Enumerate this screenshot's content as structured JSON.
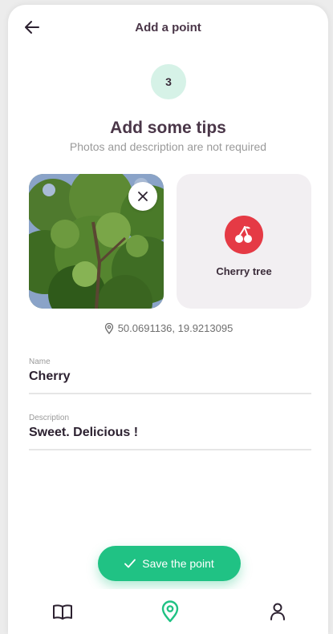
{
  "header": {
    "title": "Add a point"
  },
  "step": {
    "number": "3"
  },
  "content": {
    "title": "Add some tips",
    "subtitle": "Photos and description are not required"
  },
  "category": {
    "label": "Cherry tree",
    "icon": "cherry-icon",
    "color": "#e53a45"
  },
  "location": {
    "coordinates": "50.0691136, 19.9213095"
  },
  "form": {
    "name_label": "Name",
    "name_value": "Cherry",
    "description_label": "Description",
    "description_value": "Sweet. Delicious !"
  },
  "actions": {
    "save_label": "Save the point"
  },
  "nav": {
    "items": [
      "guide-book-icon",
      "map-pin-icon",
      "profile-icon"
    ]
  },
  "colors": {
    "accent": "#20c284",
    "title": "#4a3648",
    "badge_bg": "#d6f2e7"
  }
}
